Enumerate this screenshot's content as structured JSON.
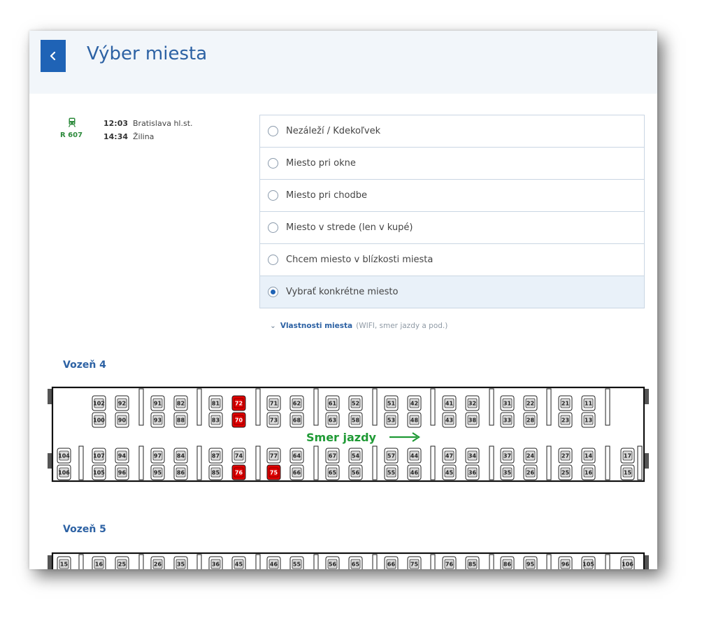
{
  "header": {
    "title": "Výber miesta",
    "back_icon": "chevron-left-icon"
  },
  "journey": {
    "train_number": "R 607",
    "departure_time": "12:03",
    "departure_station": "Bratislava hl.st.",
    "arrival_time": "14:34",
    "arrival_station": "Žilina"
  },
  "seat_options": [
    {
      "label": "Nezáleží / Kdekoľvek",
      "selected": false
    },
    {
      "label": "Miesto pri okne",
      "selected": false
    },
    {
      "label": "Miesto pri chodbe",
      "selected": false
    },
    {
      "label": "Miesto v strede (len v kupé)",
      "selected": false
    },
    {
      "label": "Chcem miesto v blízkosti miesta",
      "selected": false
    },
    {
      "label": "Vybrať konkrétne miesto",
      "selected": true
    }
  ],
  "properties": {
    "link": "Vlastnosti miesta",
    "hint": "(WIFI, smer jazdy a pod.)"
  },
  "colors": {
    "accent": "#1f63b6",
    "title": "#2d62a4",
    "direction": "#1f9a35",
    "seat_free": "#d9d9d9",
    "seat_selected": "#e00000"
  },
  "cars": [
    {
      "label": "Vozeň 4",
      "direction_label": "Smer jazdy",
      "selected_seats": [
        "72",
        "70",
        "76",
        "75"
      ],
      "row_top": [
        [
          "102",
          "92"
        ],
        [
          "91",
          "82"
        ],
        [
          "81",
          "72"
        ],
        [
          "71",
          "62"
        ],
        [
          "61",
          "52"
        ],
        [
          "51",
          "42"
        ],
        [
          "41",
          "32"
        ],
        [
          "31",
          "22"
        ],
        [
          "21",
          "11"
        ]
      ],
      "row_second": [
        [
          "100",
          "90"
        ],
        [
          "93",
          "88"
        ],
        [
          "83",
          "70"
        ],
        [
          "73",
          "68"
        ],
        [
          "63",
          "58"
        ],
        [
          "53",
          "48"
        ],
        [
          "43",
          "38"
        ],
        [
          "33",
          "28"
        ],
        [
          "23",
          "13"
        ]
      ],
      "row_third": [
        [
          "104"
        ],
        [
          "107",
          "94"
        ],
        [
          "97",
          "84"
        ],
        [
          "87",
          "74"
        ],
        [
          "77",
          "64"
        ],
        [
          "67",
          "54"
        ],
        [
          "57",
          "44"
        ],
        [
          "47",
          "34"
        ],
        [
          "37",
          "24"
        ],
        [
          "27",
          "14"
        ],
        [
          "17"
        ]
      ],
      "row_bottom": [
        [
          "106"
        ],
        [
          "105",
          "96"
        ],
        [
          "95",
          "86"
        ],
        [
          "85",
          "76"
        ],
        [
          "75",
          "66"
        ],
        [
          "65",
          "56"
        ],
        [
          "55",
          "46"
        ],
        [
          "45",
          "36"
        ],
        [
          "35",
          "26"
        ],
        [
          "25",
          "16"
        ],
        [
          "15"
        ]
      ]
    },
    {
      "label": "Vozeň 5",
      "row_top": [
        [
          "15"
        ],
        [
          "16",
          "25"
        ],
        [
          "26",
          "35"
        ],
        [
          "36",
          "45"
        ],
        [
          "46",
          "55"
        ],
        [
          "56",
          "65"
        ],
        [
          "66",
          "75"
        ],
        [
          "76",
          "85"
        ],
        [
          "86",
          "95"
        ],
        [
          "96",
          "105"
        ],
        [
          "106"
        ]
      ]
    }
  ]
}
